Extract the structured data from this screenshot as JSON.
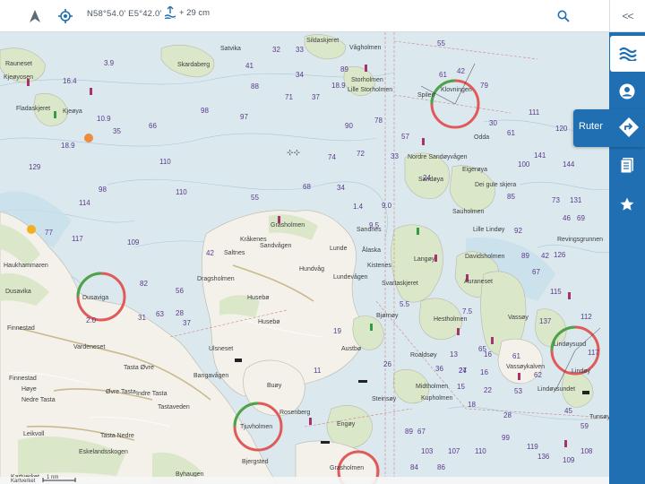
{
  "topbar": {
    "coordinates": "N58°54.0' E5°42.0'",
    "tide": "+ 29 cm",
    "collapse_label": "<<"
  },
  "sidebar": {
    "routes_label": "Ruter"
  },
  "icons": {
    "north": "north-arrow-icon",
    "locate": "locate-icon",
    "tide": "tide-icon",
    "search": "search-icon",
    "sea": "waves-icon",
    "profile": "profile-icon",
    "routes": "route-diamond-icon",
    "logbook": "logbook-icon",
    "favorites": "star-icon"
  },
  "colors": {
    "sidebar": "#1f6fb2",
    "water": "#dbe9ef",
    "land": "#f3f1ea",
    "vegetation": "#dbe7c9",
    "depth_text": "#5a3a8a"
  },
  "map": {
    "place_names": [
      "Satvika",
      "Sildaskjeret",
      "Vågholmen",
      "Skardaberg",
      "Storholmen",
      "Lille Storholmen",
      "Rauneset",
      "Kjeøyosen",
      "Fladaskjeret",
      "Kjeøya",
      "Spilen",
      "Klovningen",
      "Odda",
      "Nordre Sandøyvågen",
      "Eigerøya",
      "Sandøya",
      "Dei gule skjera",
      "Sauholmen",
      "Lille Lindøy",
      "Revingsgrunnen",
      "Sandnes",
      "Ålaska",
      "Grasholmen",
      "Kråkenes",
      "Saltnes",
      "Sandvågen",
      "Lunde",
      "Hundvåg",
      "Dragsholmen",
      "Kistenes",
      "Langøy",
      "Davidsholmen",
      "Lundevågen",
      "Svartaskjeret",
      "Auraneset",
      "Vassøy",
      "Husebø",
      "Bjørnøy",
      "Hestholmen",
      "Uthalmen",
      "Lindøysund",
      "Lindøy",
      "Austbø",
      "Roaldsøy",
      "Vassøykalven",
      "Ulsneset",
      "Bangavågen",
      "Buøy",
      "Midtholmen",
      "Kupholmen",
      "Steinsøy",
      "Lindøysundet",
      "Tunsøy",
      "Dusavika",
      "Dusaviga",
      "Haukhammaren",
      "Finnestad",
      "Finnestad Høye",
      "Vardeneset",
      "Tasta Øvre",
      "Øvre Tasta",
      "Indre Tasta",
      "Tastaveden",
      "Nedre Tasta",
      "Tasta Nedre",
      "Eskelandsskogen",
      "Leikvoll",
      "Rosenberg",
      "Tjuvholmen",
      "Engøy",
      "Bjergsted",
      "Byhaugen",
      "Kartverket"
    ],
    "scale_label": "1 nm",
    "depths": [
      "32",
      "33",
      "42",
      "55",
      "3.9",
      "16.4",
      "10.9",
      "18.9",
      "129",
      "98",
      "114",
      "117",
      "109",
      "77",
      "82",
      "56",
      "41",
      "88",
      "71",
      "37",
      "34",
      "89",
      "98",
      "97",
      "110",
      "110",
      "74",
      "72",
      "68",
      "34",
      "55",
      "78",
      "66",
      "42",
      "90",
      "17",
      "13",
      "14",
      "29",
      "76",
      "68",
      "35",
      "38",
      "24",
      "23",
      "30",
      "61",
      "40",
      "111",
      "100",
      "120",
      "141",
      "144",
      "85",
      "73",
      "131",
      "46",
      "69",
      "92",
      "89",
      "42",
      "67",
      "126",
      "115",
      "137",
      "112",
      "117",
      "99",
      "47",
      "103",
      "110",
      "109",
      "108",
      "119",
      "136",
      "86",
      "84",
      "67",
      "36",
      "27",
      "22",
      "13",
      "15",
      "10",
      "9.0",
      "9.5",
      "7.5",
      "2.0",
      "1.4",
      "35",
      "31",
      "63",
      "28",
      "37",
      "61",
      "65",
      "62",
      "45",
      "53",
      "19",
      "24",
      "16",
      "59",
      "28",
      "18",
      "11",
      "26"
    ]
  }
}
